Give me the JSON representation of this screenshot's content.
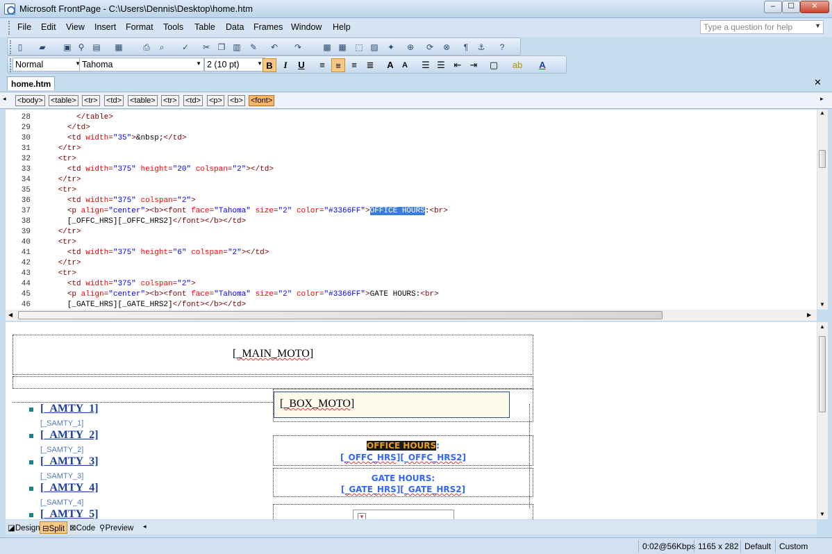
{
  "window": {
    "title": "Microsoft FrontPage - C:\\Users\\Dennis\\Desktop\\home.htm",
    "min": "–",
    "max": "☐",
    "close": "✕"
  },
  "menu": [
    "File",
    "Edit",
    "View",
    "Insert",
    "Format",
    "Tools",
    "Table",
    "Data",
    "Frames",
    "Window",
    "Help"
  ],
  "help_placeholder": "Type a question for help",
  "format": {
    "style": "Normal",
    "font": "Tahoma",
    "size": "2  (10 pt)"
  },
  "doc_tab": "home.htm",
  "tags": [
    "<body>",
    "<table>",
    "<tr>",
    "<td>",
    "<table>",
    "<tr>",
    "<td>",
    "<p>",
    "<b>",
    "<font>"
  ],
  "code_lines": [
    {
      "n": "28",
      "parts": [
        [
          "tx",
          "        "
        ],
        [
          "tg",
          "</table>"
        ]
      ]
    },
    {
      "n": "29",
      "parts": [
        [
          "tx",
          "      "
        ],
        [
          "tg",
          "</td>"
        ]
      ]
    },
    {
      "n": "30",
      "parts": [
        [
          "tx",
          "      "
        ],
        [
          "tg",
          "<td "
        ],
        [
          "at",
          "width"
        ],
        [
          "tg",
          "="
        ],
        [
          "vl",
          "\"35\""
        ],
        [
          "tg",
          ">"
        ],
        [
          "tx",
          "&nbsp;"
        ],
        [
          "tg",
          "</td>"
        ]
      ]
    },
    {
      "n": "31",
      "parts": [
        [
          "tx",
          "    "
        ],
        [
          "tg",
          "</tr>"
        ]
      ]
    },
    {
      "n": "32",
      "parts": [
        [
          "tx",
          "    "
        ],
        [
          "tg",
          "<tr>"
        ]
      ]
    },
    {
      "n": "33",
      "parts": [
        [
          "tx",
          "      "
        ],
        [
          "tg",
          "<td "
        ],
        [
          "at",
          "width"
        ],
        [
          "tg",
          "="
        ],
        [
          "vl",
          "\"375\""
        ],
        [
          "tg",
          " "
        ],
        [
          "at",
          "height"
        ],
        [
          "tg",
          "="
        ],
        [
          "vl",
          "\"20\""
        ],
        [
          "tg",
          " "
        ],
        [
          "at",
          "colspan"
        ],
        [
          "tg",
          "="
        ],
        [
          "vl",
          "\"2\""
        ],
        [
          "tg",
          "></td>"
        ]
      ]
    },
    {
      "n": "34",
      "parts": [
        [
          "tx",
          "    "
        ],
        [
          "tg",
          "</tr>"
        ]
      ]
    },
    {
      "n": "35",
      "parts": [
        [
          "tx",
          "    "
        ],
        [
          "tg",
          "<tr>"
        ]
      ]
    },
    {
      "n": "36",
      "parts": [
        [
          "tx",
          "      "
        ],
        [
          "tg",
          "<td "
        ],
        [
          "at",
          "width"
        ],
        [
          "tg",
          "="
        ],
        [
          "vl",
          "\"375\""
        ],
        [
          "tg",
          " "
        ],
        [
          "at",
          "colspan"
        ],
        [
          "tg",
          "="
        ],
        [
          "vl",
          "\"2\""
        ],
        [
          "tg",
          ">"
        ]
      ]
    },
    {
      "n": "37",
      "parts": [
        [
          "tx",
          "      "
        ],
        [
          "tg",
          "<p "
        ],
        [
          "at",
          "align"
        ],
        [
          "tg",
          "="
        ],
        [
          "vl",
          "\"center\""
        ],
        [
          "tg",
          "><b><font "
        ],
        [
          "at",
          "face"
        ],
        [
          "tg",
          "="
        ],
        [
          "vl",
          "\"Tahoma\""
        ],
        [
          "tg",
          " "
        ],
        [
          "at",
          "size"
        ],
        [
          "tg",
          "="
        ],
        [
          "vl",
          "\"2\""
        ],
        [
          "tg",
          " "
        ],
        [
          "at",
          "color"
        ],
        [
          "tg",
          "="
        ],
        [
          "vl",
          "\"#3366FF\""
        ],
        [
          "tg",
          ">"
        ],
        [
          "hl",
          "OFFICE HOURS"
        ],
        [
          "tx",
          ":"
        ],
        [
          "tg",
          "<br>"
        ]
      ]
    },
    {
      "n": "38",
      "parts": [
        [
          "tx",
          "      [_OFFC_HRS][_OFFC_HRS2]"
        ],
        [
          "tg",
          "</font></b></td>"
        ]
      ]
    },
    {
      "n": "39",
      "parts": [
        [
          "tx",
          "    "
        ],
        [
          "tg",
          "</tr>"
        ]
      ]
    },
    {
      "n": "40",
      "parts": [
        [
          "tx",
          "    "
        ],
        [
          "tg",
          "<tr>"
        ]
      ]
    },
    {
      "n": "41",
      "parts": [
        [
          "tx",
          "      "
        ],
        [
          "tg",
          "<td "
        ],
        [
          "at",
          "width"
        ],
        [
          "tg",
          "="
        ],
        [
          "vl",
          "\"375\""
        ],
        [
          "tg",
          " "
        ],
        [
          "at",
          "height"
        ],
        [
          "tg",
          "="
        ],
        [
          "vl",
          "\"6\""
        ],
        [
          "tg",
          " "
        ],
        [
          "at",
          "colspan"
        ],
        [
          "tg",
          "="
        ],
        [
          "vl",
          "\"2\""
        ],
        [
          "tg",
          "></td>"
        ]
      ]
    },
    {
      "n": "42",
      "parts": [
        [
          "tx",
          "    "
        ],
        [
          "tg",
          "</tr>"
        ]
      ]
    },
    {
      "n": "43",
      "parts": [
        [
          "tx",
          "    "
        ],
        [
          "tg",
          "<tr>"
        ]
      ]
    },
    {
      "n": "44",
      "parts": [
        [
          "tx",
          "      "
        ],
        [
          "tg",
          "<td "
        ],
        [
          "at",
          "width"
        ],
        [
          "tg",
          "="
        ],
        [
          "vl",
          "\"375\""
        ],
        [
          "tg",
          " "
        ],
        [
          "at",
          "colspan"
        ],
        [
          "tg",
          "="
        ],
        [
          "vl",
          "\"2\""
        ],
        [
          "tg",
          ">"
        ]
      ]
    },
    {
      "n": "45",
      "parts": [
        [
          "tx",
          "      "
        ],
        [
          "tg",
          "<p "
        ],
        [
          "at",
          "align"
        ],
        [
          "tg",
          "="
        ],
        [
          "vl",
          "\"center\""
        ],
        [
          "tg",
          "><b><font "
        ],
        [
          "at",
          "face"
        ],
        [
          "tg",
          "="
        ],
        [
          "vl",
          "\"Tahoma\""
        ],
        [
          "tg",
          " "
        ],
        [
          "at",
          "size"
        ],
        [
          "tg",
          "="
        ],
        [
          "vl",
          "\"2\""
        ],
        [
          "tg",
          " "
        ],
        [
          "at",
          "color"
        ],
        [
          "tg",
          "="
        ],
        [
          "vl",
          "\"#3366FF\""
        ],
        [
          "tg",
          ">"
        ],
        [
          "tx",
          "GATE HOURS:"
        ],
        [
          "tg",
          "<br>"
        ]
      ]
    },
    {
      "n": "46",
      "parts": [
        [
          "tx",
          "      [_GATE_HRS][_GATE_HRS2]"
        ],
        [
          "tg",
          "</font></b></td>"
        ]
      ]
    }
  ],
  "design": {
    "main_moto": "[_MAIN_MOTO]",
    "box_moto": "[_BOX_MOTO]",
    "amenities": [
      {
        "title": "[_AMTY_1]",
        "sub": "[_SAMTY_1]"
      },
      {
        "title": "[_AMTY_2]",
        "sub": "[_SAMTY_2]"
      },
      {
        "title": "[_AMTY_3]",
        "sub": "[_SAMTY_3]"
      },
      {
        "title": "[_AMTY_4]",
        "sub": "[_SAMTY_4]"
      },
      {
        "title": "[_AMTY_5]",
        "sub": ""
      }
    ],
    "office_label": "OFFICE HOURS",
    "office_colon": ":",
    "office_value": "[_OFFC_HRS][_OFFC_HRS2]",
    "gate_label": "GATE HOURS:",
    "gate_value": "[_GATE_HRS][_GATE_HRS2]"
  },
  "views": [
    "Design",
    "Split",
    "Code",
    "Preview"
  ],
  "status": {
    "speed": "0:02@56Kbps",
    "dims": "1165 x 282",
    "mode": "Default",
    "custom": "Custom"
  },
  "colors": {
    "link": "#1b3f9e",
    "font_color": "#3366FF"
  }
}
